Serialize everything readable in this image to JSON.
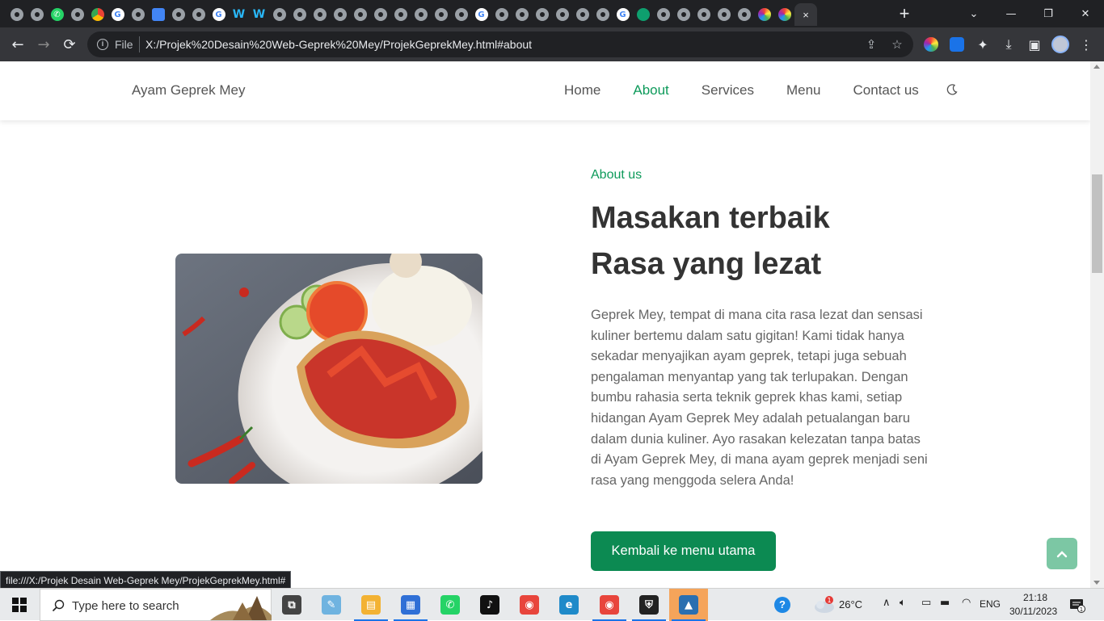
{
  "browser": {
    "tab_favicons": [
      "generic",
      "generic",
      "whatsapp",
      "generic",
      "chrome",
      "google",
      "generic",
      "translate",
      "generic",
      "generic",
      "google",
      "wave",
      "wave",
      "generic",
      "generic",
      "generic",
      "generic",
      "generic",
      "generic",
      "generic",
      "generic",
      "generic",
      "generic",
      "google",
      "generic",
      "generic",
      "generic",
      "generic",
      "generic",
      "generic",
      "google",
      "spot",
      "generic",
      "generic",
      "generic",
      "generic",
      "generic",
      "ring",
      "ring"
    ],
    "active_tab_close": "×",
    "new_tab": "+",
    "scheme_label": "File",
    "url": "X:/Projek%20Desain%20Web-Geprek%20Mey/ProjekGeprekMey.html#about",
    "status_url": "file:///X:/Projek Desain Web-Geprek Mey/ProjekGeprekMey.html#",
    "window_controls": {
      "dropdown": "⌄",
      "minimize": "—",
      "restore": "❐",
      "close": "✕"
    }
  },
  "site": {
    "brand": "Ayam Geprek Mey",
    "nav": [
      {
        "label": "Home",
        "active": false
      },
      {
        "label": "About",
        "active": true
      },
      {
        "label": "Services",
        "active": false
      },
      {
        "label": "Menu",
        "active": false
      },
      {
        "label": "Contact us",
        "active": false
      }
    ],
    "about": {
      "subtitle": "About us",
      "title_line1": "Masakan terbaik",
      "title_line2": "Rasa yang lezat",
      "body": "Geprek Mey, tempat di mana cita rasa lezat dan sensasi kuliner bertemu dalam satu gigitan! Kami tidak hanya sekadar menyajikan ayam geprek, tetapi juga sebuah pengalaman menyantap yang tak terlupakan. Dengan bumbu rahasia serta teknik geprek khas kami, setiap hidangan Ayam Geprek Mey adalah petualangan baru dalam dunia kuliner. Ayo rasakan kelezatan tanpa batas di Ayam Geprek Mey, di mana ayam geprek menjadi seni rasa yang menggoda selera Anda!",
      "button": "Kembali ke menu utama"
    },
    "colors": {
      "accent": "#0d9a5a",
      "button": "#0c8a52",
      "scroll_top": "#7cc7a4"
    }
  },
  "taskbar": {
    "search_placeholder": "Type here to search",
    "apps": [
      "task-view",
      "notepad",
      "file-explorer",
      "news",
      "whatsapp",
      "tiktok",
      "chrome",
      "edge",
      "chrome-active",
      "security",
      "photos"
    ],
    "temperature": "26°C",
    "weather_badge": "1",
    "language": "ENG",
    "time": "21:18",
    "date": "30/11/2023",
    "notification_count": "1"
  }
}
